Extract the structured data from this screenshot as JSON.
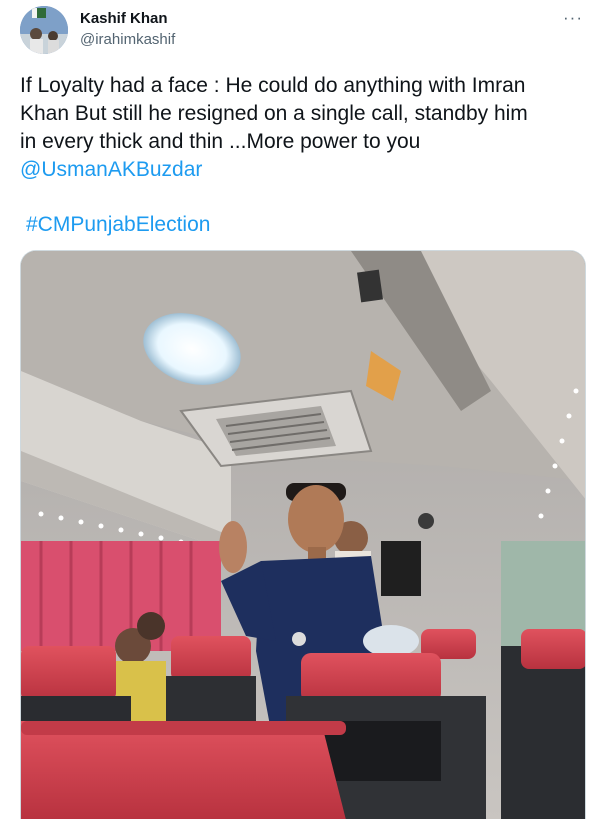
{
  "author": {
    "display_name": "Kashif Khan",
    "handle": "@irahimkashif",
    "avatar_icon": "avatar-photo"
  },
  "more_icon": "more-horizontal-icon",
  "more_label": "···",
  "tweet": {
    "line1": "If Loyalty had  a face : He could do anything with Imran",
    "line2": "Khan But still he resigned on a single call, standby him",
    "line3": "in every thick and thin ...More power to you",
    "mention": "@UsmanAKBuzdar",
    "hashtag": "#CMPunjabElection"
  },
  "media": {
    "type": "photo",
    "subject": "bus-interior-photo"
  },
  "colors": {
    "text": "#0f1419",
    "secondary": "#536471",
    "link": "#1d9bf0",
    "border": "#cfd9de"
  }
}
